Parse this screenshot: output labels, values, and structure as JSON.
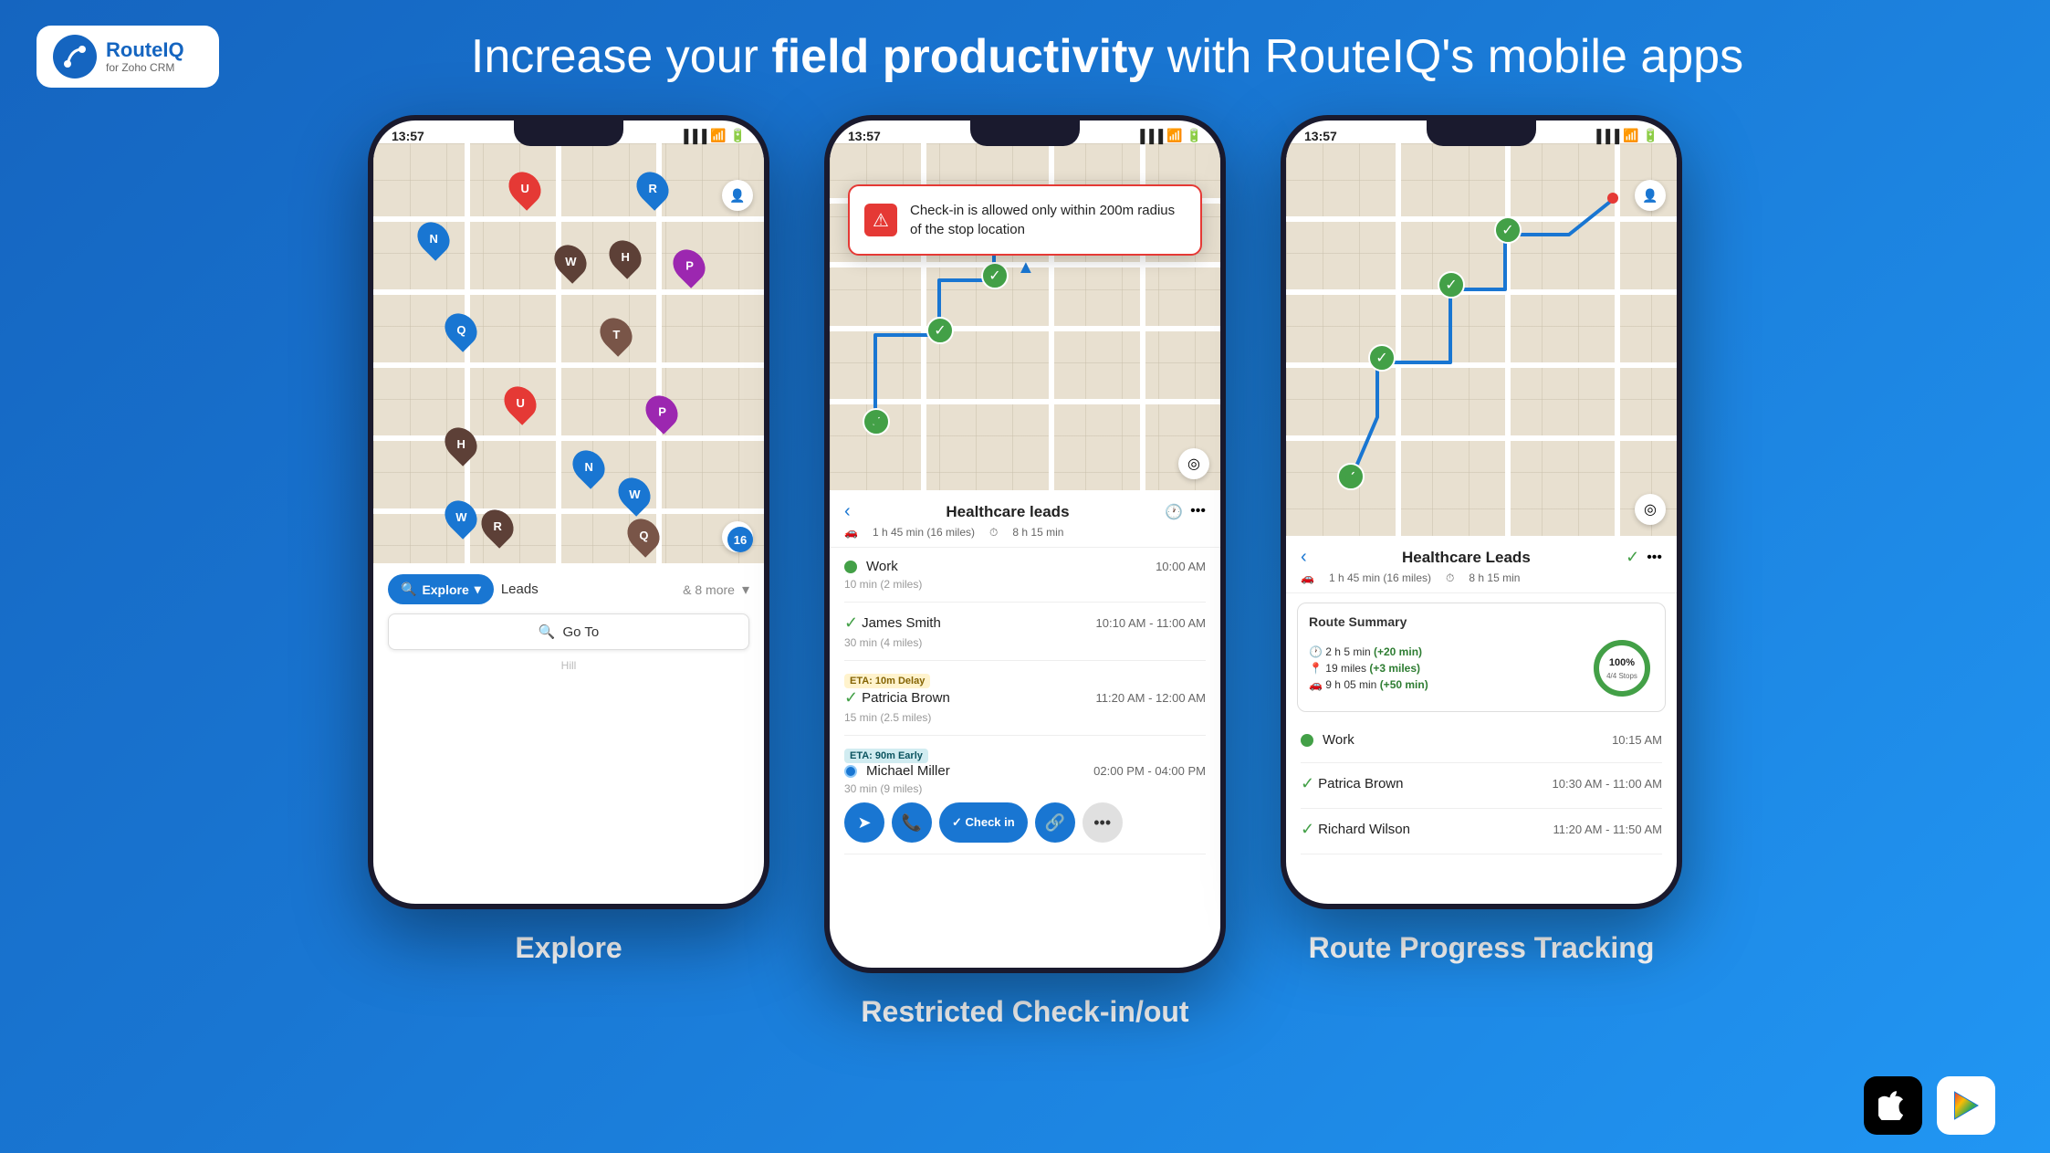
{
  "header": {
    "logo_name": "RouteIQ",
    "logo_sub": "for Zoho CRM",
    "title_normal": "Increase your ",
    "title_bold": "field productivity",
    "title_end": " with RouteIQ's mobile apps"
  },
  "phones": [
    {
      "id": "explore",
      "status_time": "13:57",
      "label": "Explore",
      "explore_btn": "Explore",
      "leads": "Leads",
      "more": "& 8 more",
      "goto": "Go To"
    },
    {
      "id": "checkin",
      "status_time": "13:57",
      "label": "Restricted Check-in/out",
      "alert": "Check-in is allowed only within 200m radius of the stop location",
      "route_title": "Healthcare leads",
      "duration": "1 h 45 min (16 miles)",
      "total_time": "8 h 15 min",
      "stops": [
        {
          "name": "Work",
          "time": "10:00 AM",
          "distance": "10 min (2 miles)",
          "type": "start"
        },
        {
          "name": "James Smith",
          "time": "10:10 AM - 11:00 AM",
          "distance": "30 min (4 miles)",
          "type": "done"
        },
        {
          "name": "Patricia Brown",
          "time": "11:20 AM - 12:00 AM",
          "distance": "15 min (2.5 miles)",
          "type": "delay",
          "eta": "ETA: 10m Delay"
        },
        {
          "name": "Michael Miller",
          "time": "02:00 PM - 04:00 PM",
          "distance": "30 min (9 miles)",
          "type": "early",
          "eta": "ETA: 90m Early"
        }
      ]
    },
    {
      "id": "progress",
      "status_time": "13:57",
      "label": "Route Progress Tracking",
      "route_title": "Healthcare Leads",
      "duration": "1 h 45 min (16 miles)",
      "total_time": "8 h 15 min",
      "summary": {
        "title": "Route Summary",
        "time": "2 h 5 min",
        "time_plus": "(+20 min)",
        "distance": "19 miles",
        "dist_plus": "(+3 miles)",
        "drive": "9 h 05 min",
        "drive_plus": "(+50 min)",
        "progress": "100%",
        "stops": "4/4 Stops"
      },
      "stops": [
        {
          "name": "Work",
          "time": "10:15 AM",
          "type": "start"
        },
        {
          "name": "Patrica Brown",
          "time": "10:30 AM - 11:00 AM",
          "type": "done"
        },
        {
          "name": "Richard Wilson",
          "time": "11:20 AM - 11:50 AM",
          "type": "done"
        }
      ]
    }
  ],
  "footer": {
    "apple_icon": "",
    "play_icon": "▶"
  }
}
